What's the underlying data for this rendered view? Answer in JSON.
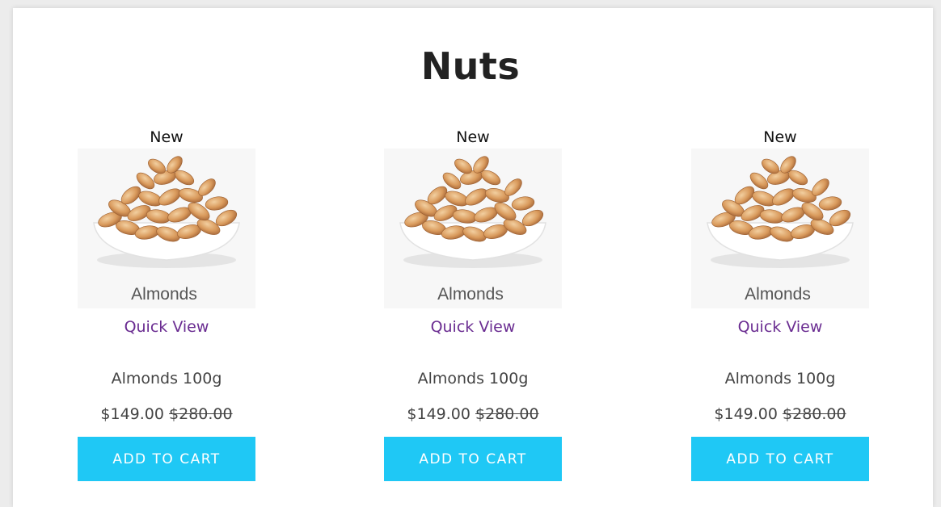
{
  "section": {
    "title": "Nuts"
  },
  "products": [
    {
      "badge": "New",
      "image_caption": "Almonds",
      "quick_view_label": "Quick View",
      "name": "Almonds 100g",
      "price": "$149.00",
      "old_price": "$280.00",
      "cart_label": "ADD TO CART"
    },
    {
      "badge": "New",
      "image_caption": "Almonds",
      "quick_view_label": "Quick View",
      "name": "Almonds 100g",
      "price": "$149.00",
      "old_price": "$280.00",
      "cart_label": "ADD TO CART"
    },
    {
      "badge": "New",
      "image_caption": "Almonds",
      "quick_view_label": "Quick View",
      "name": "Almonds 100g",
      "price": "$149.00",
      "old_price": "$280.00",
      "cart_label": "ADD TO CART"
    }
  ],
  "colors": {
    "button": "#1fc8f5",
    "link": "#6a2c91",
    "text": "#444444"
  }
}
